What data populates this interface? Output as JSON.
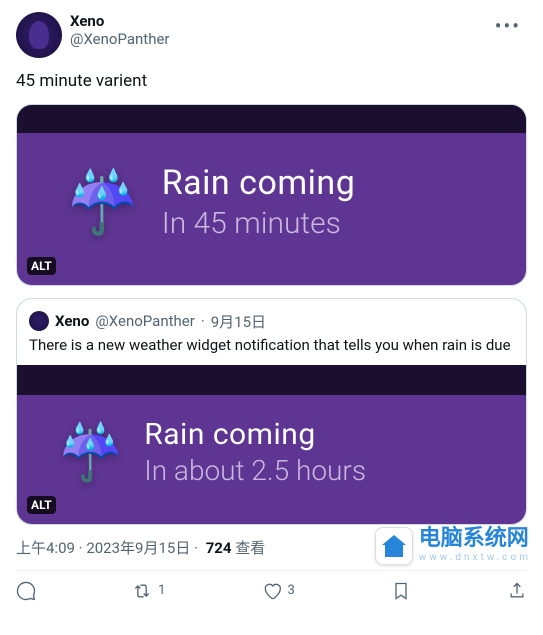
{
  "author": {
    "display_name": "Xeno",
    "handle": "@XenoPanther"
  },
  "tweet_text": "45 minute varient",
  "media1": {
    "alt_label": "ALT",
    "title": "Rain coming",
    "subtitle": "In 45 minutes",
    "icon": "☔"
  },
  "quote": {
    "author_name": "Xeno",
    "author_handle": "@XenoPanther",
    "date": "9月15日",
    "text": "There is a new weather widget notification that tells you when rain is due",
    "media": {
      "alt_label": "ALT",
      "title": "Rain coming",
      "subtitle": "In about 2.5 hours",
      "icon": "☔"
    }
  },
  "meta": {
    "time": "上午4:09",
    "date": "2023年9月15日",
    "views_count": "724",
    "views_label": "查看"
  },
  "actions": {
    "retweets": "1",
    "likes": "3"
  },
  "watermark": {
    "text": "电脑系统网",
    "sub": "www.dnxtw.com"
  }
}
